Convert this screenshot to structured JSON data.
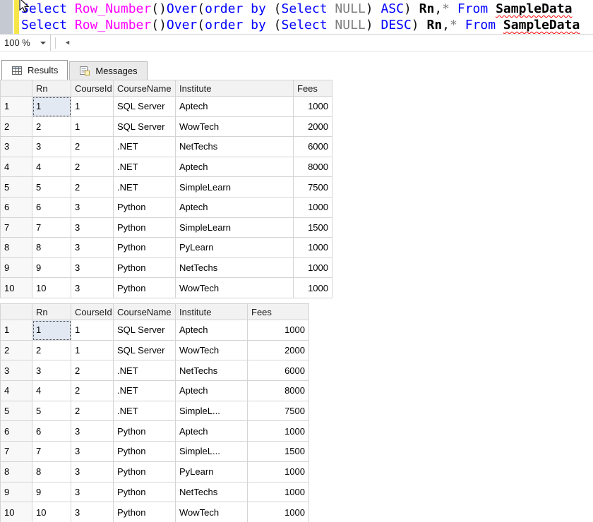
{
  "editor": {
    "lines": [
      {
        "tokens": [
          {
            "t": "Select ",
            "c": "kw"
          },
          {
            "t": "Row_Number",
            "c": "fn"
          },
          {
            "t": "()",
            "c": "pl"
          },
          {
            "t": "Over",
            "c": "kw"
          },
          {
            "t": "(",
            "c": "pl"
          },
          {
            "t": "order by",
            "c": "kw"
          },
          {
            "t": " (",
            "c": "pl"
          },
          {
            "t": "Select",
            "c": "kw"
          },
          {
            "t": " ",
            "c": "pl"
          },
          {
            "t": "NULL",
            "c": "gy"
          },
          {
            "t": ")",
            "c": "pl"
          },
          {
            "t": " ",
            "c": "pl"
          },
          {
            "t": "ASC",
            "c": "kw"
          },
          {
            "t": ")",
            "c": "pl"
          },
          {
            "t": " ",
            "c": "pl"
          },
          {
            "t": "Rn",
            "c": "bd"
          },
          {
            "t": ",",
            "c": "pl"
          },
          {
            "t": "*",
            "c": "gy"
          },
          {
            "t": " ",
            "c": "pl"
          },
          {
            "t": "From",
            "c": "kw"
          },
          {
            "t": " ",
            "c": "pl"
          },
          {
            "t": "SampleData",
            "c": "err"
          }
        ]
      },
      {
        "tokens": [
          {
            "t": "Select ",
            "c": "kw"
          },
          {
            "t": "Row_Number",
            "c": "fn"
          },
          {
            "t": "()",
            "c": "pl"
          },
          {
            "t": "Over",
            "c": "kw"
          },
          {
            "t": "(",
            "c": "pl"
          },
          {
            "t": "order by",
            "c": "kw"
          },
          {
            "t": " (",
            "c": "pl"
          },
          {
            "t": "Select",
            "c": "kw"
          },
          {
            "t": " ",
            "c": "pl"
          },
          {
            "t": "NULL",
            "c": "gy"
          },
          {
            "t": ")",
            "c": "pl"
          },
          {
            "t": " ",
            "c": "pl"
          },
          {
            "t": "DESC",
            "c": "kw"
          },
          {
            "t": ")",
            "c": "pl"
          },
          {
            "t": " ",
            "c": "pl"
          },
          {
            "t": "Rn",
            "c": "bd"
          },
          {
            "t": ",",
            "c": "pl"
          },
          {
            "t": "*",
            "c": "gy"
          },
          {
            "t": " ",
            "c": "pl"
          },
          {
            "t": "From",
            "c": "kw"
          },
          {
            "t": " ",
            "c": "pl"
          },
          {
            "t": "SampleData",
            "c": "err"
          }
        ]
      }
    ]
  },
  "status": {
    "zoom_value": "100 %"
  },
  "results_tabs": {
    "results": "Results",
    "messages": "Messages"
  },
  "grids": [
    {
      "name": "results-grid-1",
      "columns": [
        "",
        "Rn",
        "CourseId",
        "CourseName",
        "Institute",
        "Fees"
      ],
      "rows": [
        [
          "1",
          "1",
          "1",
          "SQL Server",
          "Aptech",
          "1000"
        ],
        [
          "2",
          "2",
          "1",
          "SQL Server",
          "WowTech",
          "2000"
        ],
        [
          "3",
          "3",
          "2",
          ".NET",
          "NetTechs",
          "6000"
        ],
        [
          "4",
          "4",
          "2",
          ".NET",
          "Aptech",
          "8000"
        ],
        [
          "5",
          "5",
          "2",
          ".NET",
          "SimpleLearn",
          "7500"
        ],
        [
          "6",
          "6",
          "3",
          "Python",
          "Aptech",
          "1000"
        ],
        [
          "7",
          "7",
          "3",
          "Python",
          "SimpleLearn",
          "1500"
        ],
        [
          "8",
          "8",
          "3",
          "Python",
          "PyLearn",
          "1000"
        ],
        [
          "9",
          "9",
          "3",
          "Python",
          "NetTechs",
          "1000"
        ],
        [
          "10",
          "10",
          "3",
          "Python",
          "WowTech",
          "1000"
        ]
      ],
      "selected_cell": {
        "row": 0,
        "col": 1
      }
    },
    {
      "name": "results-grid-2",
      "columns": [
        "",
        "Rn",
        "CourseId",
        "CourseName",
        "Institute",
        "Fees"
      ],
      "rows": [
        [
          "1",
          "1",
          "1",
          "SQL Server",
          "Aptech",
          "1000"
        ],
        [
          "2",
          "2",
          "1",
          "SQL Server",
          "WowTech",
          "2000"
        ],
        [
          "3",
          "3",
          "2",
          ".NET",
          "NetTechs",
          "6000"
        ],
        [
          "4",
          "4",
          "2",
          ".NET",
          "Aptech",
          "8000"
        ],
        [
          "5",
          "5",
          "2",
          ".NET",
          "SimpleL...",
          "7500"
        ],
        [
          "6",
          "6",
          "3",
          "Python",
          "Aptech",
          "1000"
        ],
        [
          "7",
          "7",
          "3",
          "Python",
          "SimpleL...",
          "1500"
        ],
        [
          "8",
          "8",
          "3",
          "Python",
          "PyLearn",
          "1000"
        ],
        [
          "9",
          "9",
          "3",
          "Python",
          "NetTechs",
          "1000"
        ],
        [
          "10",
          "10",
          "3",
          "Python",
          "WowTech",
          "1000"
        ]
      ],
      "selected_cell": {
        "row": 0,
        "col": 1
      }
    }
  ],
  "colors": {
    "keyword": "#0000ff",
    "function": "#ff00ff",
    "null_gray": "#808080",
    "error_underline": "#ff0000",
    "change_bar": "#f7e64a",
    "selected_cell": "#e2e9f3"
  }
}
